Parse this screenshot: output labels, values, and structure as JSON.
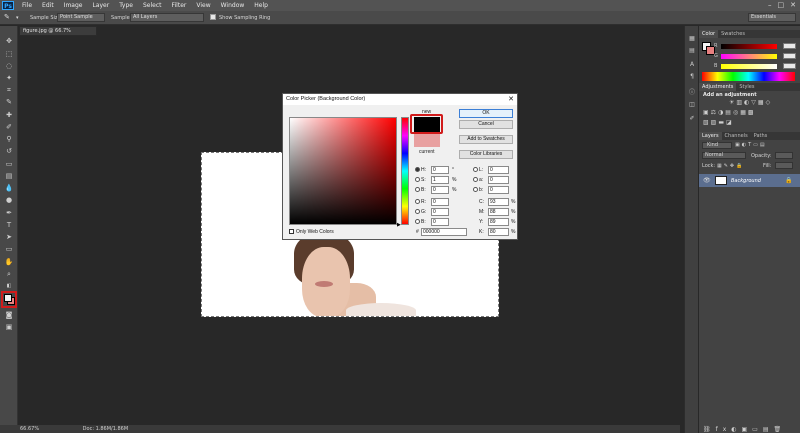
{
  "app": {
    "logo": "Ps",
    "menu": [
      "File",
      "Edit",
      "Image",
      "Layer",
      "Type",
      "Select",
      "Filter",
      "View",
      "Window",
      "Help"
    ],
    "workspace": "Essentials",
    "window_controls": [
      "–",
      "□",
      "✕"
    ]
  },
  "options": {
    "sample_size_label": "Sample Size:",
    "sample_size_value": "Point Sample",
    "sample_label": "Sample:",
    "sample_value": "All Layers",
    "sampling_ring_label": "Show Sampling Ring"
  },
  "document": {
    "tab_title": "figure.jpg @ 66.7% (RGB/8#) *",
    "tab_close": "×",
    "zoom": "66.67%",
    "doc_info": "Doc: 1.86M/1.86M"
  },
  "panels": {
    "color_tabs": [
      "Color",
      "Swatches"
    ],
    "adjustments_tabs": [
      "Adjustments",
      "Styles"
    ],
    "adjustments_title": "Add an adjustment",
    "layers_tabs": [
      "Layers",
      "Channels",
      "Paths"
    ],
    "layers_kind": "Kind",
    "layers_blend": "Normal",
    "layers_opacity_label": "Opacity:",
    "layers_lock_label": "Lock:",
    "layers_fill_label": "Fill:",
    "layer_name": "Background",
    "color_sliders": [
      {
        "label": "R",
        "value": ""
      },
      {
        "label": "G",
        "value": ""
      },
      {
        "label": "B",
        "value": ""
      }
    ]
  },
  "dialog": {
    "title": "Color Picker (Background Color)",
    "close": "✕",
    "new_label": "new",
    "current_label": "current",
    "buttons": {
      "ok": "OK",
      "cancel": "Cancel",
      "add": "Add to Swatches",
      "libraries": "Color Libraries"
    },
    "only_web": "Only Web Colors",
    "fields": {
      "H": {
        "label": "H:",
        "value": "0",
        "unit": "°"
      },
      "S": {
        "label": "S:",
        "value": "1",
        "unit": "%"
      },
      "Bv": {
        "label": "B:",
        "value": "0",
        "unit": "%"
      },
      "R": {
        "label": "R:",
        "value": "0"
      },
      "G": {
        "label": "G:",
        "value": "0"
      },
      "B": {
        "label": "B:",
        "value": "0"
      },
      "L": {
        "label": "L:",
        "value": "0"
      },
      "a": {
        "label": "a:",
        "value": "0"
      },
      "b": {
        "label": "b:",
        "value": "0"
      },
      "C": {
        "label": "C:",
        "value": "93",
        "unit": "%"
      },
      "M": {
        "label": "M:",
        "value": "88",
        "unit": "%"
      },
      "Y": {
        "label": "Y:",
        "value": "89",
        "unit": "%"
      },
      "K": {
        "label": "K:",
        "value": "80",
        "unit": "%"
      },
      "hex": {
        "label": "#",
        "value": "000000"
      }
    }
  },
  "colors": {
    "new": "#000000",
    "current": "#e8a0a0",
    "highlight": "#d11b1b"
  }
}
